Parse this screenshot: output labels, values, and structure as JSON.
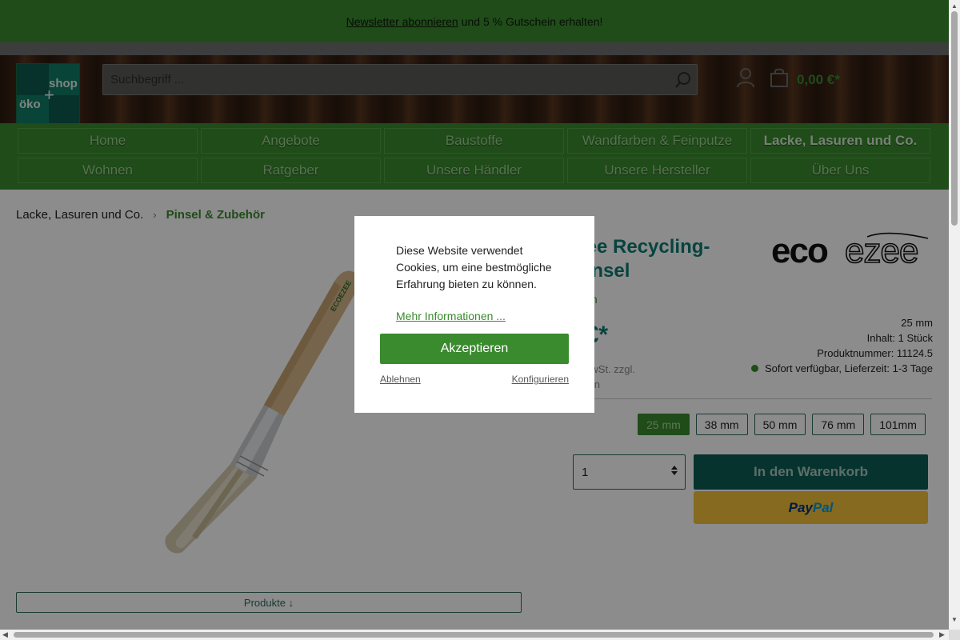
{
  "newsletter": {
    "link_text": "Newsletter abonnieren",
    "rest_text": "und 5 % Gutschein erhalten!"
  },
  "logo": {
    "text_oko": "öko",
    "text_shop": "shop",
    "plus": "+"
  },
  "search": {
    "placeholder": "Suchbegriff ...",
    "icon": "search-icon"
  },
  "header": {
    "account_icon": "user-icon",
    "cart_icon": "bag-icon",
    "cart_total": "0,00 €*"
  },
  "nav": {
    "items": [
      {
        "label": "Home"
      },
      {
        "label": "Angebote"
      },
      {
        "label": "Baustoffe"
      },
      {
        "label": "Wandfarben & Feinputze"
      },
      {
        "label": "Lacke, Lasuren und Co."
      },
      {
        "label": "Wohnen"
      },
      {
        "label": "Ratgeber"
      },
      {
        "label": "Unsere Händler"
      },
      {
        "label": "Unsere Hersteller"
      },
      {
        "label": "Über Uns"
      }
    ],
    "active": "Lacke, Lasuren und Co."
  },
  "breadcrumb": {
    "parent": "Lacke, Lasuren und Co.",
    "separator": "›",
    "current": "Pinsel & Zubehör"
  },
  "product": {
    "title_line1": "oEzee Recycling-",
    "title_line2": "chpinsel",
    "variant_link": "m",
    "price": "34 €*",
    "tax_line1": "e inkl. MwSt. zzgl.",
    "tax_line2": "andkosten",
    "brand": "ecoezee",
    "meta": {
      "size": "25 mm",
      "content": "Inhalt: 1 Stück",
      "product_number": "Produktnummer: 11124.5",
      "availability": "Sofort verfügbar, Lieferzeit: 1-3 Tage"
    },
    "variants": [
      "25 mm",
      "38 mm",
      "50 mm",
      "76 mm",
      "101mm"
    ],
    "selected_variant": "25 mm",
    "quantity": "1",
    "add_to_cart": "In den Warenkorb",
    "paypal_part1": "Pay",
    "paypal_part2": "Pal",
    "products_button": "Produkte ↓"
  },
  "cookie": {
    "text": "Diese Website verwendet Cookies, um eine bestmögliche Erfahrung bieten zu können.",
    "more": "Mehr Informationen ...",
    "accept": "Akzeptieren",
    "decline": "Ablehnen",
    "configure": "Konfigurieren"
  },
  "colors": {
    "brand_green": "#3a8a2e",
    "teal": "#0d7a73",
    "dark_teal": "#0d5e55",
    "paypal_yellow": "#f3c13a"
  }
}
